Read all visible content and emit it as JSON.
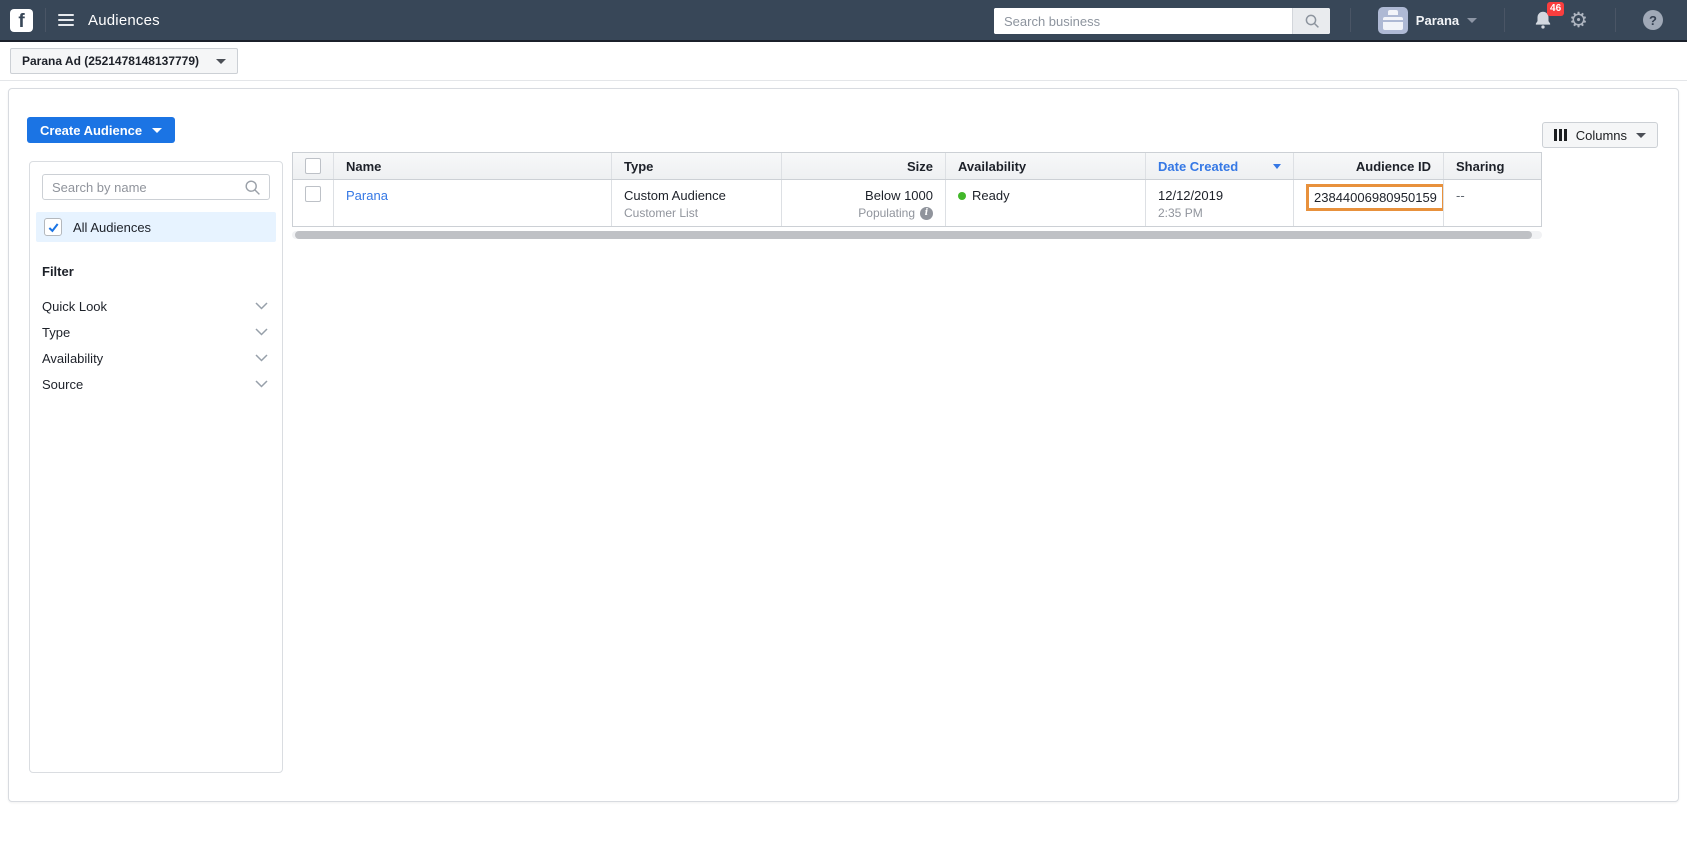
{
  "topnav": {
    "app_title": "Audiences",
    "search_placeholder": "Search business",
    "user_name": "Parana",
    "notification_count": "46",
    "logo_letter": "f",
    "help_glyph": "?",
    "gear_glyph": "⚙"
  },
  "account_bar": {
    "account_selector_label": "Parana Ad (2521478148137779)"
  },
  "toolbar": {
    "create_audience_label": "Create Audience",
    "columns_label": "Columns"
  },
  "sidebar": {
    "search_placeholder": "Search by name",
    "all_audiences_label": "All Audiences",
    "filter_heading": "Filter",
    "filters": [
      {
        "label": "Quick Look"
      },
      {
        "label": "Type"
      },
      {
        "label": "Availability"
      },
      {
        "label": "Source"
      }
    ]
  },
  "table": {
    "columns": [
      "Name",
      "Type",
      "Size",
      "Availability",
      "Date Created",
      "Audience ID",
      "Sharing"
    ],
    "sorted_column": "Date Created",
    "sort_direction": "descending",
    "rows": [
      {
        "name": "Parana",
        "type_primary": "Custom Audience",
        "type_secondary": "Customer List",
        "size_primary": "Below 1000",
        "size_secondary": "Populating",
        "availability": "Ready",
        "date_created": "12/12/2019",
        "time_created": "2:35 PM",
        "audience_id": "23844006980950159",
        "sharing": "--"
      }
    ]
  },
  "colors": {
    "navbar_bg": "#384758",
    "accent_blue": "#1b74e4",
    "link_blue": "#3578e5",
    "ready_green": "#42b72a",
    "highlight_orange": "#e8913c",
    "badge_red": "#fa3e3e",
    "selected_row_bg": "#e7f3ff"
  }
}
